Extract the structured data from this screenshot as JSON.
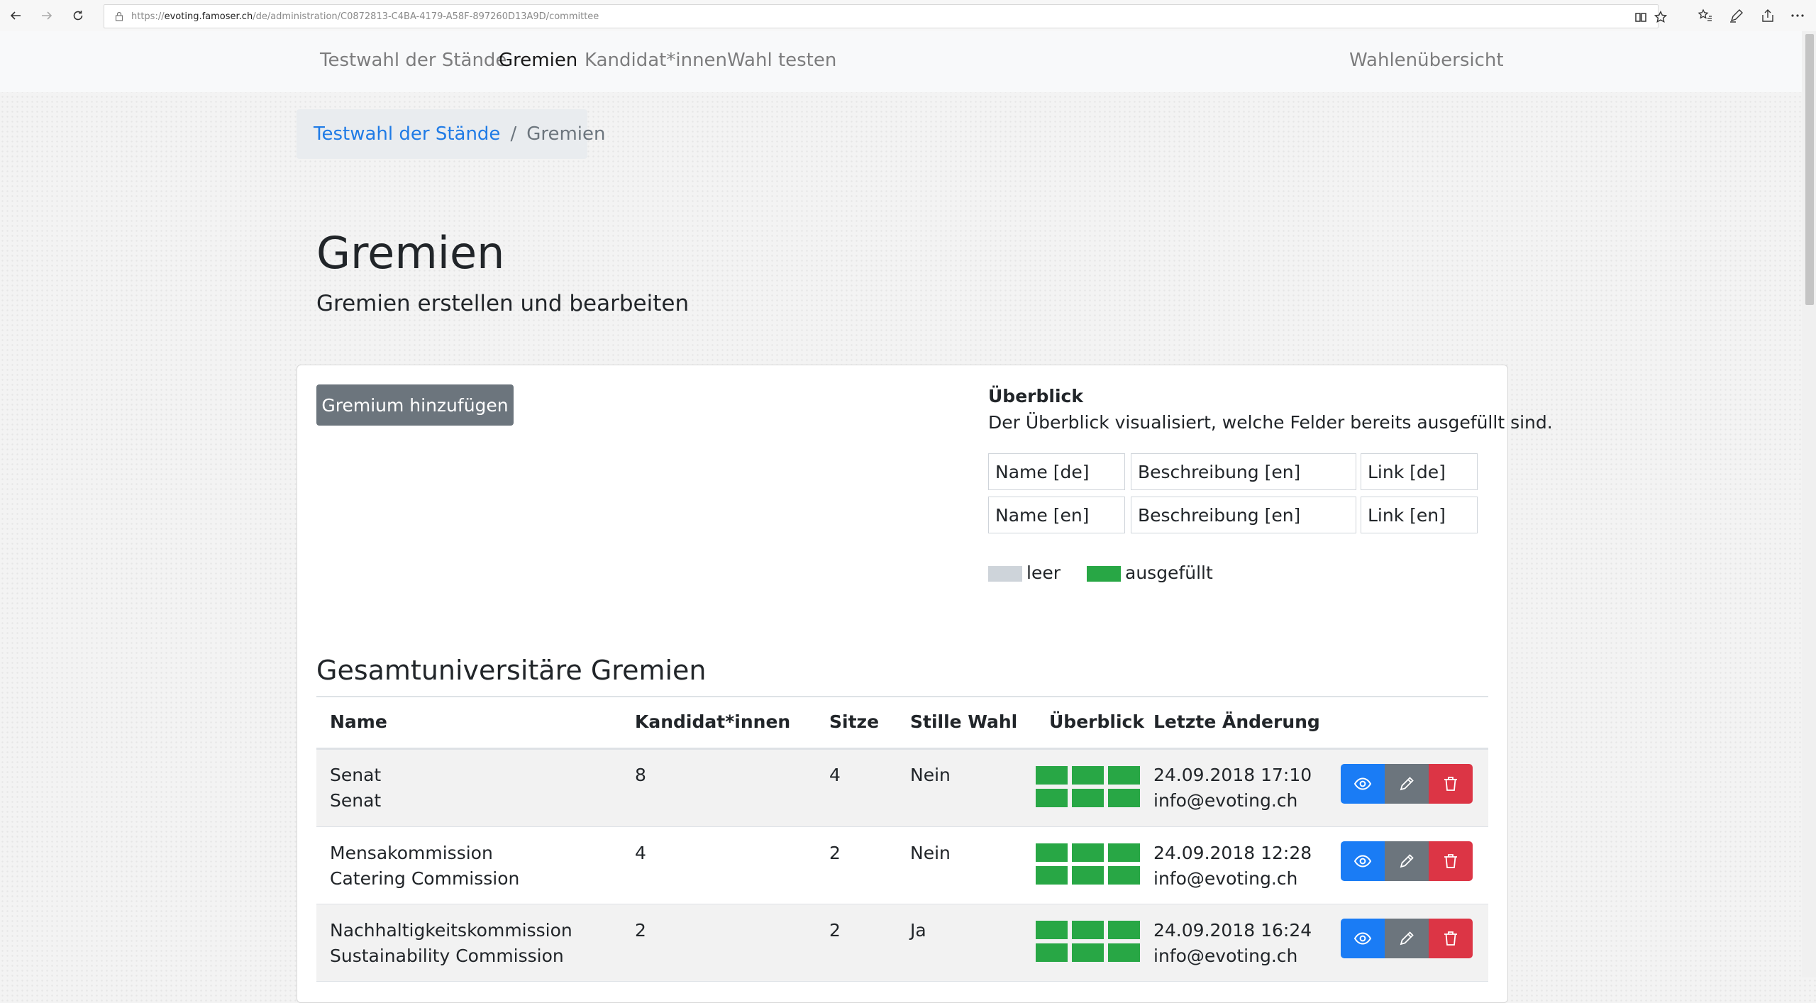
{
  "browser": {
    "url_prefix": "https://",
    "url_host": "evoting.famoser.ch",
    "url_path": "/de/administration/C0872813-C4BA-4179-A58F-897260D13A9D/committee"
  },
  "navbar": {
    "items": [
      {
        "label": "Testwahl der Stände",
        "active": false
      },
      {
        "label": "Gremien",
        "active": true
      },
      {
        "label": "Kandidat*innen",
        "active": false
      },
      {
        "label": "Wahl testen",
        "active": false
      }
    ],
    "right_link": "Wahlenübersicht"
  },
  "breadcrumb": {
    "parent": "Testwahl der Stände",
    "separator": "/",
    "current": "Gremien"
  },
  "header": {
    "title": "Gremien",
    "subtitle": "Gremien erstellen und bearbeiten"
  },
  "actions": {
    "add_label": "Gremium hinzufügen"
  },
  "overview": {
    "title": "Überblick",
    "description": "Der Überblick visualisiert, welche Felder bereits ausgefüllt sind.",
    "grid": [
      [
        "Name [de]",
        "Beschreibung [en]",
        "Link [de]"
      ],
      [
        "Name [en]",
        "Beschreibung [en]",
        "Link [en]"
      ]
    ],
    "legend": [
      {
        "label": "leer",
        "color": "#ced4da"
      },
      {
        "label": "ausgefüllt",
        "color": "#28a745"
      }
    ]
  },
  "section": {
    "title": "Gesamtuniversitäre Gremien"
  },
  "table": {
    "headers": {
      "name": "Name",
      "candidates": "Kandidat*innen",
      "seats": "Sitze",
      "silent": "Stille Wahl",
      "overview": "Überblick",
      "last_change": "Letzte Änderung"
    },
    "rows": [
      {
        "name_de": "Senat",
        "name_en": "Senat",
        "candidates": "8",
        "seats": "4",
        "silent": "Nein",
        "date": "24.09.2018 17:10",
        "user": "info@evoting.ch"
      },
      {
        "name_de": "Mensakommission",
        "name_en": "Catering Commission",
        "candidates": "4",
        "seats": "2",
        "silent": "Nein",
        "date": "24.09.2018 12:28",
        "user": "info@evoting.ch"
      },
      {
        "name_de": "Nachhaltigkeitskommission",
        "name_en": "Sustainability Commission",
        "candidates": "2",
        "seats": "2",
        "silent": "Ja",
        "date": "24.09.2018 16:24",
        "user": "info@evoting.ch"
      }
    ]
  },
  "colors": {
    "primary": "#1a7cf5",
    "secondary": "#6c757d",
    "danger": "#dc3545",
    "success": "#28a745"
  }
}
